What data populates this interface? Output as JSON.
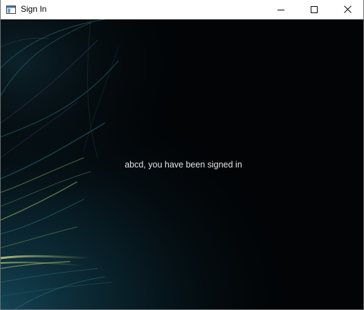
{
  "window": {
    "title": "Sign In",
    "icons": {
      "app": "window-app-icon",
      "minimize": "minimize-icon",
      "maximize": "maximize-icon",
      "close": "close-icon"
    }
  },
  "content": {
    "message": "abcd, you have been signed in",
    "background": "dark abstract wallpaper with teal and yellow-green swirl strands",
    "colors": {
      "background": "#020406",
      "message_text": "#e6e6e6",
      "accent_teal": "#1e6b7a",
      "accent_yellow_green": "#b9c96a"
    }
  }
}
